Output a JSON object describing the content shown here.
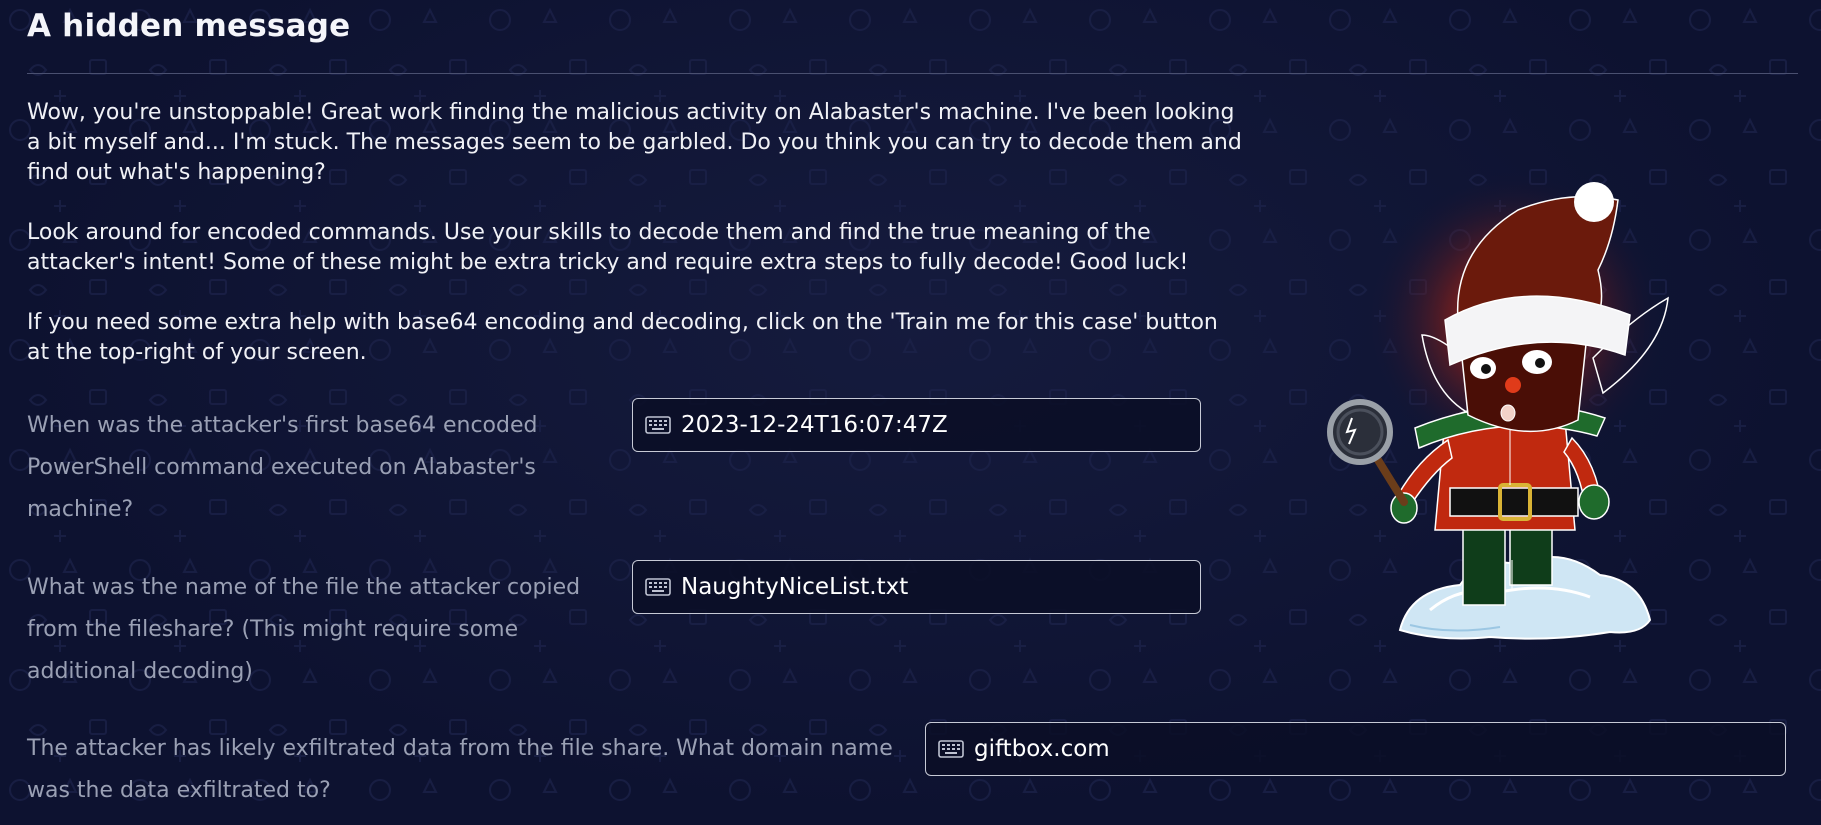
{
  "header": {
    "title": "A hidden message"
  },
  "intro": {
    "p1_lines": [
      "Wow, you're unstoppable! Great work finding the malicious activity on Alabaster's machine. I've been looking",
      "a bit myself and... I'm stuck. The messages seem to be garbled. Do you think you can try to decode them and",
      "find out what's happening?"
    ],
    "p2_lines": [
      "Look around for encoded commands. Use your skills to decode them and find the true meaning of the",
      "attacker's intent! Some of these might be extra tricky and require extra steps to fully decode! Good luck!"
    ],
    "p3_lines": [
      "If you need some extra help with base64 encoding and decoding, click on the 'Train me for this case' button",
      "at the top-right of your screen."
    ]
  },
  "questions": [
    {
      "lines": [
        "When was the attacker's first base64 encoded",
        "PowerShell command executed on Alabaster's",
        "machine?"
      ],
      "answer": "2023-12-24T16:07:47Z"
    },
    {
      "lines": [
        "What was the name of the file the attacker copied",
        "from the fileshare? (This might require some",
        "additional decoding)"
      ],
      "answer": "NaughtyNiceList.txt"
    },
    {
      "lines": [
        "The attacker has likely exfiltrated data from the file share. What domain name",
        "was the data exfiltrated to?"
      ],
      "answer": "giftbox.com"
    }
  ],
  "icons": {
    "input_icon": "keyboard-icon",
    "illustration": "elf-with-magnifying-glass"
  },
  "colors": {
    "background": "#0d1230",
    "text": "#f0f1f6",
    "question_text": "#9aa0b4",
    "input_border": "#c7cad6",
    "elf_suit": "#c0290f",
    "elf_glow": "#ff4a1a"
  }
}
